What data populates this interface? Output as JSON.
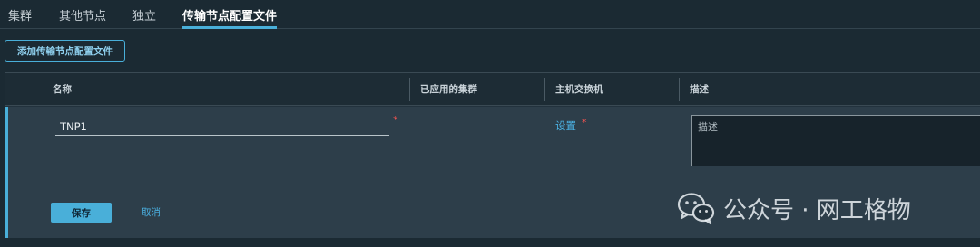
{
  "tabs": [
    {
      "label": "集群",
      "active": false
    },
    {
      "label": "其他节点",
      "active": false
    },
    {
      "label": "独立",
      "active": false
    },
    {
      "label": "传输节点配置文件",
      "active": true
    }
  ],
  "toolbar": {
    "add_label": "添加传输节点配置文件"
  },
  "grid": {
    "columns": {
      "name": "名称",
      "applied_clusters": "已应用的集群",
      "host_switch": "主机交换机",
      "description": "描述"
    },
    "edit_row": {
      "name_value": "TNP1",
      "required_mark": "*",
      "switch_link": "设置",
      "description_placeholder": "描述",
      "save_label": "保存",
      "cancel_label": "取消"
    }
  },
  "watermark": {
    "text": "公众号 · 网工格物",
    "icon": "wechat-icon"
  },
  "colors": {
    "accent": "#49afd9",
    "background": "#1b2a33",
    "required": "#ef5350"
  }
}
